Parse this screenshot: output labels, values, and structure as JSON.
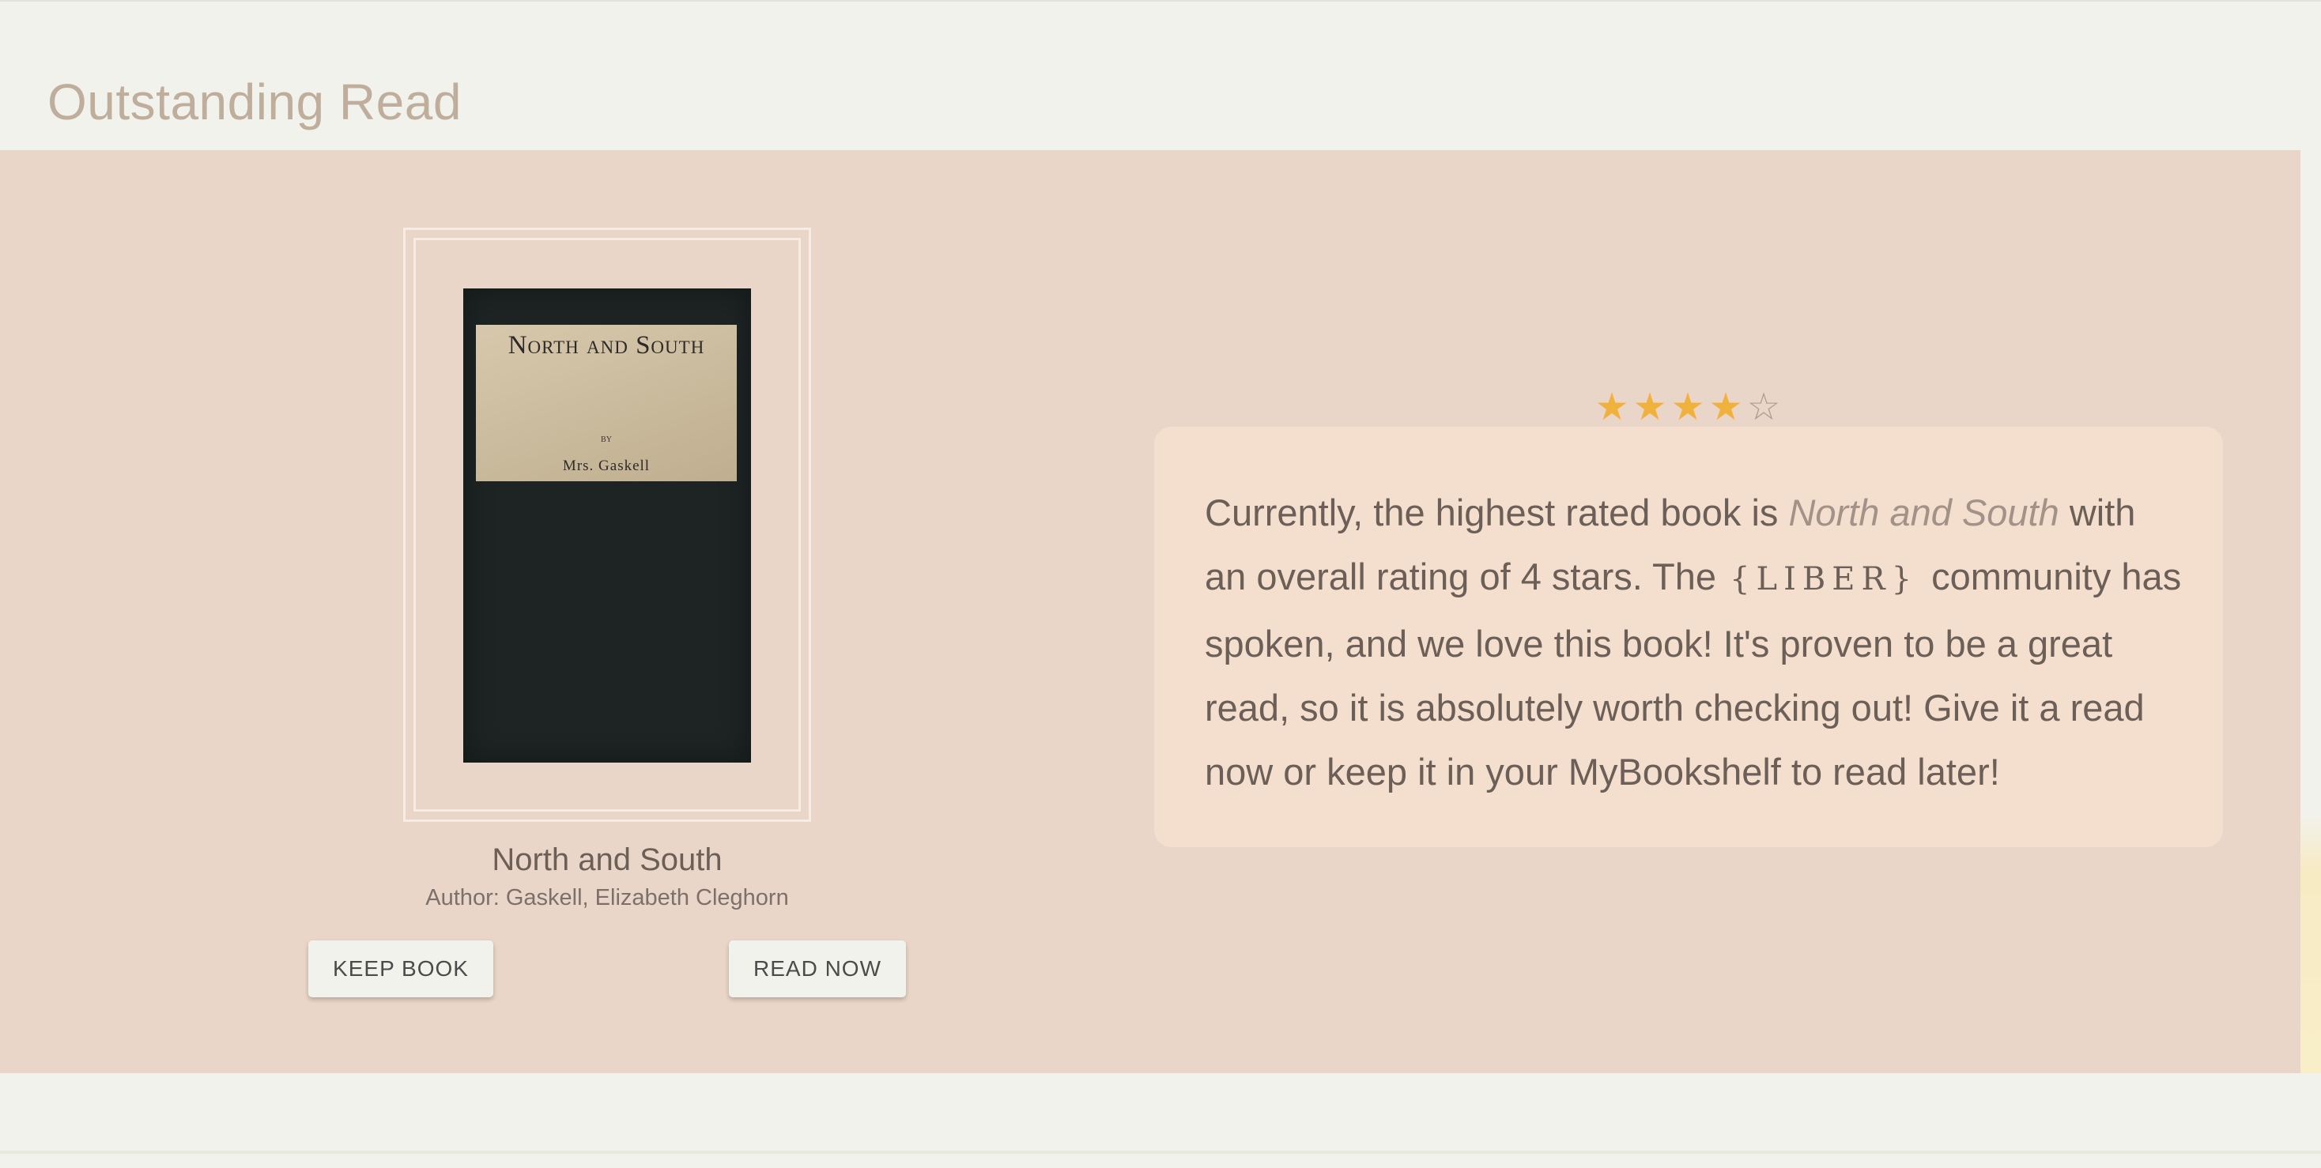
{
  "section": {
    "title": "Outstanding Read"
  },
  "book": {
    "cover_title": "North and South",
    "cover_by": "BY",
    "cover_author": "Mrs. Gaskell",
    "title": "North and South",
    "author": "Author: Gaskell, Elizabeth Cleghorn"
  },
  "buttons": {
    "keep": "Keep Book",
    "read": "Read Now"
  },
  "rating": {
    "value": 4,
    "max": 5,
    "filled_color": "#f0b23d"
  },
  "quote": {
    "part1": "Currently, the highest rated book is ",
    "book_name": "North and South",
    "part2": " with an overall rating of 4 stars. The ",
    "logo": "{LIBER}",
    "part3": " community has spoken, and we love this book! It's proven to be a great read, so it is absolutely worth checking out! Give it a read now or keep it in your MyBookshelf to read later!"
  },
  "colors": {
    "band": "#e9d6c8",
    "card": "#f4dfcf",
    "title": "#bfae9c"
  }
}
